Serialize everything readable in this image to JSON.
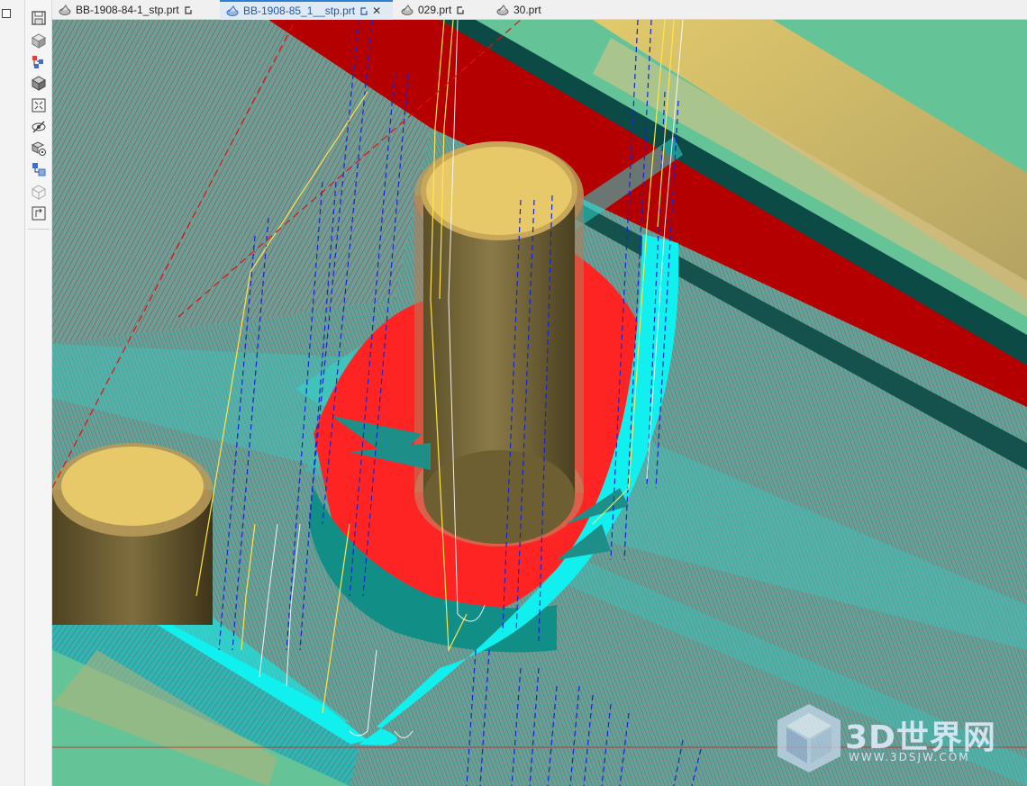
{
  "tabs": [
    {
      "label": "BB-1908-84-1_stp.prt",
      "active": false,
      "modified": true,
      "closable": false
    },
    {
      "label": "BB-1908-85_1__stp.prt",
      "active": true,
      "modified": true,
      "closable": true
    },
    {
      "label": "029.prt",
      "active": false,
      "modified": true,
      "closable": false
    },
    {
      "label": "30.prt",
      "active": false,
      "modified": false,
      "closable": false
    }
  ],
  "toolbar": {
    "tools": [
      {
        "icon": "save-icon"
      },
      {
        "icon": "shaded-cube-icon"
      },
      {
        "icon": "assembly-navigator-icon"
      },
      {
        "icon": "solid-cube-icon"
      },
      {
        "icon": "fit-view-icon"
      },
      {
        "icon": "hide-show-icon"
      },
      {
        "icon": "settings-cube-icon"
      },
      {
        "icon": "part-navigator-icon"
      },
      {
        "icon": "wireframe-cube-icon"
      },
      {
        "icon": "reset-orientation-icon"
      }
    ]
  },
  "watermark": {
    "title": "3D世界网",
    "url": "WWW.3DSJW.COM"
  },
  "colors": {
    "background": "#64c497",
    "wall_red": "#b40000",
    "pocket_red": "#ff2424",
    "cyan_toolpath": "#11f0ef",
    "stock_gold": "#e8c96a",
    "cylinder_body": "#7a6a3a",
    "dark_teal_band": "#0c4a45",
    "active_tab": "#dfeaf5"
  }
}
